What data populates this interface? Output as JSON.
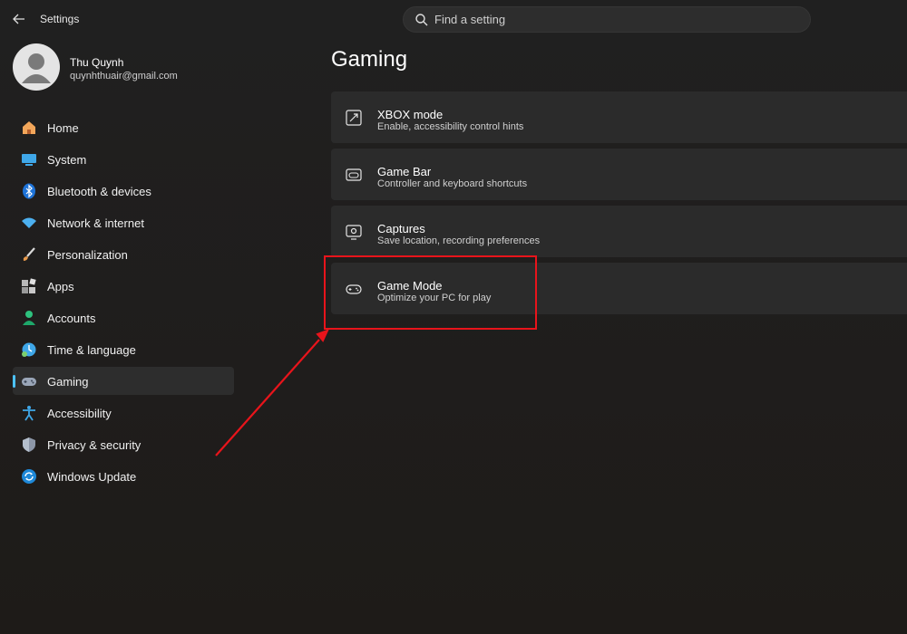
{
  "window": {
    "title": "Settings"
  },
  "search": {
    "placeholder": "Find a setting"
  },
  "profile": {
    "name": "Thu Quynh",
    "email": "quynhthuair@gmail.com"
  },
  "sidebar": {
    "items": [
      {
        "label": "Home",
        "icon": "home-icon",
        "active": false
      },
      {
        "label": "System",
        "icon": "system-icon",
        "active": false
      },
      {
        "label": "Bluetooth & devices",
        "icon": "bluetooth-icon",
        "active": false
      },
      {
        "label": "Network & internet",
        "icon": "wifi-icon",
        "active": false
      },
      {
        "label": "Personalization",
        "icon": "brush-icon",
        "active": false
      },
      {
        "label": "Apps",
        "icon": "apps-icon",
        "active": false
      },
      {
        "label": "Accounts",
        "icon": "accounts-icon",
        "active": false
      },
      {
        "label": "Time & language",
        "icon": "time-language-icon",
        "active": false
      },
      {
        "label": "Gaming",
        "icon": "gaming-icon",
        "active": true
      },
      {
        "label": "Accessibility",
        "icon": "accessibility-icon",
        "active": false
      },
      {
        "label": "Privacy & security",
        "icon": "shield-icon",
        "active": false
      },
      {
        "label": "Windows Update",
        "icon": "update-icon",
        "active": false
      }
    ]
  },
  "main": {
    "title": "Gaming",
    "cards": [
      {
        "title": "XBOX mode",
        "subtitle": "Enable, accessibility control hints",
        "icon": "xbox-mode-icon"
      },
      {
        "title": "Game Bar",
        "subtitle": "Controller and keyboard shortcuts",
        "icon": "game-bar-icon"
      },
      {
        "title": "Captures",
        "subtitle": "Save location, recording preferences",
        "icon": "captures-icon"
      },
      {
        "title": "Game Mode",
        "subtitle": "Optimize your PC for play",
        "icon": "game-mode-icon"
      }
    ]
  },
  "colors": {
    "accent": "#4cc2ff",
    "annotation": "#e8141b",
    "card": "#2b2b2b",
    "background": "#202020"
  }
}
